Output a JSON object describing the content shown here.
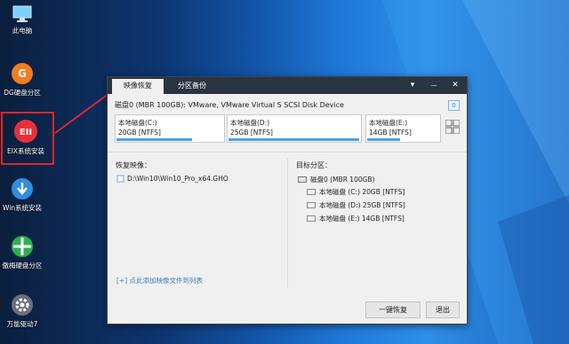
{
  "desktop": {
    "icons": [
      {
        "name": "this-pc-icon",
        "label": "此电脑"
      },
      {
        "name": "dg-partition-icon",
        "label": "DG硬盘分区"
      },
      {
        "name": "eix-install-icon",
        "label": "EIX系统安装"
      },
      {
        "name": "win-install-icon",
        "label": "Win系统安装"
      },
      {
        "name": "disk-partition-icon",
        "label": "傲梅硬盘分区"
      },
      {
        "name": "driver-icon",
        "label": "万能驱动7"
      }
    ],
    "eix_glyph": "EII",
    "dg_glyph": "G"
  },
  "window": {
    "tabs": [
      "映像恢复",
      "分区备份"
    ],
    "controls": {
      "menu": "▾",
      "minimize": "—",
      "close": "✕"
    },
    "disk_title": "磁盘0 (MBR 100GB): VMware, VMware Virtual S SCSI Disk Device",
    "disk_badge": "0",
    "partitions": [
      {
        "name": "本地磁盘(C:)",
        "size": "20GB [NTFS]",
        "used": 0.7
      },
      {
        "name": "本地磁盘(D:)",
        "size": "25GB [NTFS]",
        "used": 0.98
      },
      {
        "name": "本地磁盘(E:)",
        "size": "14GB [NTFS]",
        "used": 0.45
      }
    ],
    "restore_label": "恢复映像：",
    "image_path": "D:\\Win10\\Win10_Pro_x64.GHO",
    "target_label": "目标分区：",
    "tree_root": "磁盘0 (MBR 100GB)",
    "tree_items": [
      "本地磁盘 (C:) 20GB [NTFS]",
      "本地磁盘 (D:) 25GB [NTFS]",
      "本地磁盘 (E:) 14GB [NTFS]"
    ],
    "add_link": "[+] 点此添加映像文件到列表",
    "buttons": {
      "restore": "一键恢复",
      "exit": "退出"
    }
  },
  "colors": {
    "accent": "#4ba3e8",
    "annotation": "#d92a2a",
    "titlebar": "#2b3441"
  }
}
